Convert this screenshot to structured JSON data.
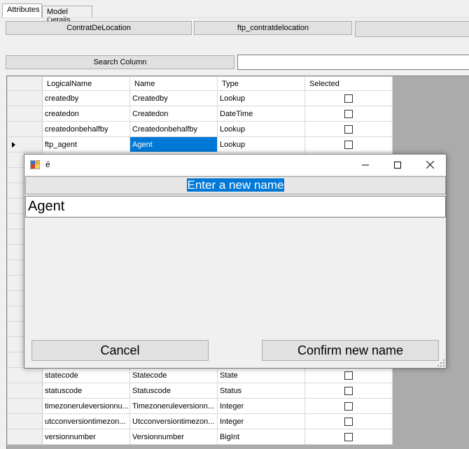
{
  "tabs": [
    {
      "label": "Attributes",
      "active": true
    },
    {
      "label": "Model Details",
      "active": false
    }
  ],
  "toolbar": {
    "entity_button": "ContratDeLocation",
    "schema_button": "ftp_contratdelocation",
    "third_button": ""
  },
  "search": {
    "button_label": "Search Column",
    "value": ""
  },
  "grid": {
    "columns": [
      "LogicalName",
      "Name",
      "Type",
      "Selected"
    ],
    "rows": [
      {
        "logical": "createdby",
        "name": "Createdby",
        "type": "Lookup",
        "selected": false,
        "current": false
      },
      {
        "logical": "createdon",
        "name": "Createdon",
        "type": "DateTime",
        "selected": false,
        "current": false
      },
      {
        "logical": "createdonbehalfby",
        "name": "Createdonbehalfby",
        "type": "Lookup",
        "selected": false,
        "current": false
      },
      {
        "logical": "ftp_agent",
        "name": "Agent",
        "type": "Lookup",
        "selected": false,
        "current": true
      }
    ],
    "bottom_rows": [
      {
        "logical": "statecode",
        "name": "Statecode",
        "type": "State",
        "selected": false
      },
      {
        "logical": "statuscode",
        "name": "Statuscode",
        "type": "Status",
        "selected": false
      },
      {
        "logical": "timezoneruleversionnu...",
        "name": "Timezoneruleversionn...",
        "type": "Integer",
        "selected": false
      },
      {
        "logical": "utcconversiontimezon...",
        "name": "Utcconversiontimezon...",
        "type": "Integer",
        "selected": false
      },
      {
        "logical": "versionnumber",
        "name": "Versionnumber",
        "type": "BigInt",
        "selected": false
      }
    ]
  },
  "dialog": {
    "title": "é",
    "prompt": "Enter a new name",
    "input_value": "Agent",
    "cancel_label": "Cancel",
    "confirm_label": "Confirm new name"
  },
  "colors": {
    "selection": "#0078d7",
    "window_bg": "#f0f0f0",
    "button_bg": "#e1e1e1"
  }
}
